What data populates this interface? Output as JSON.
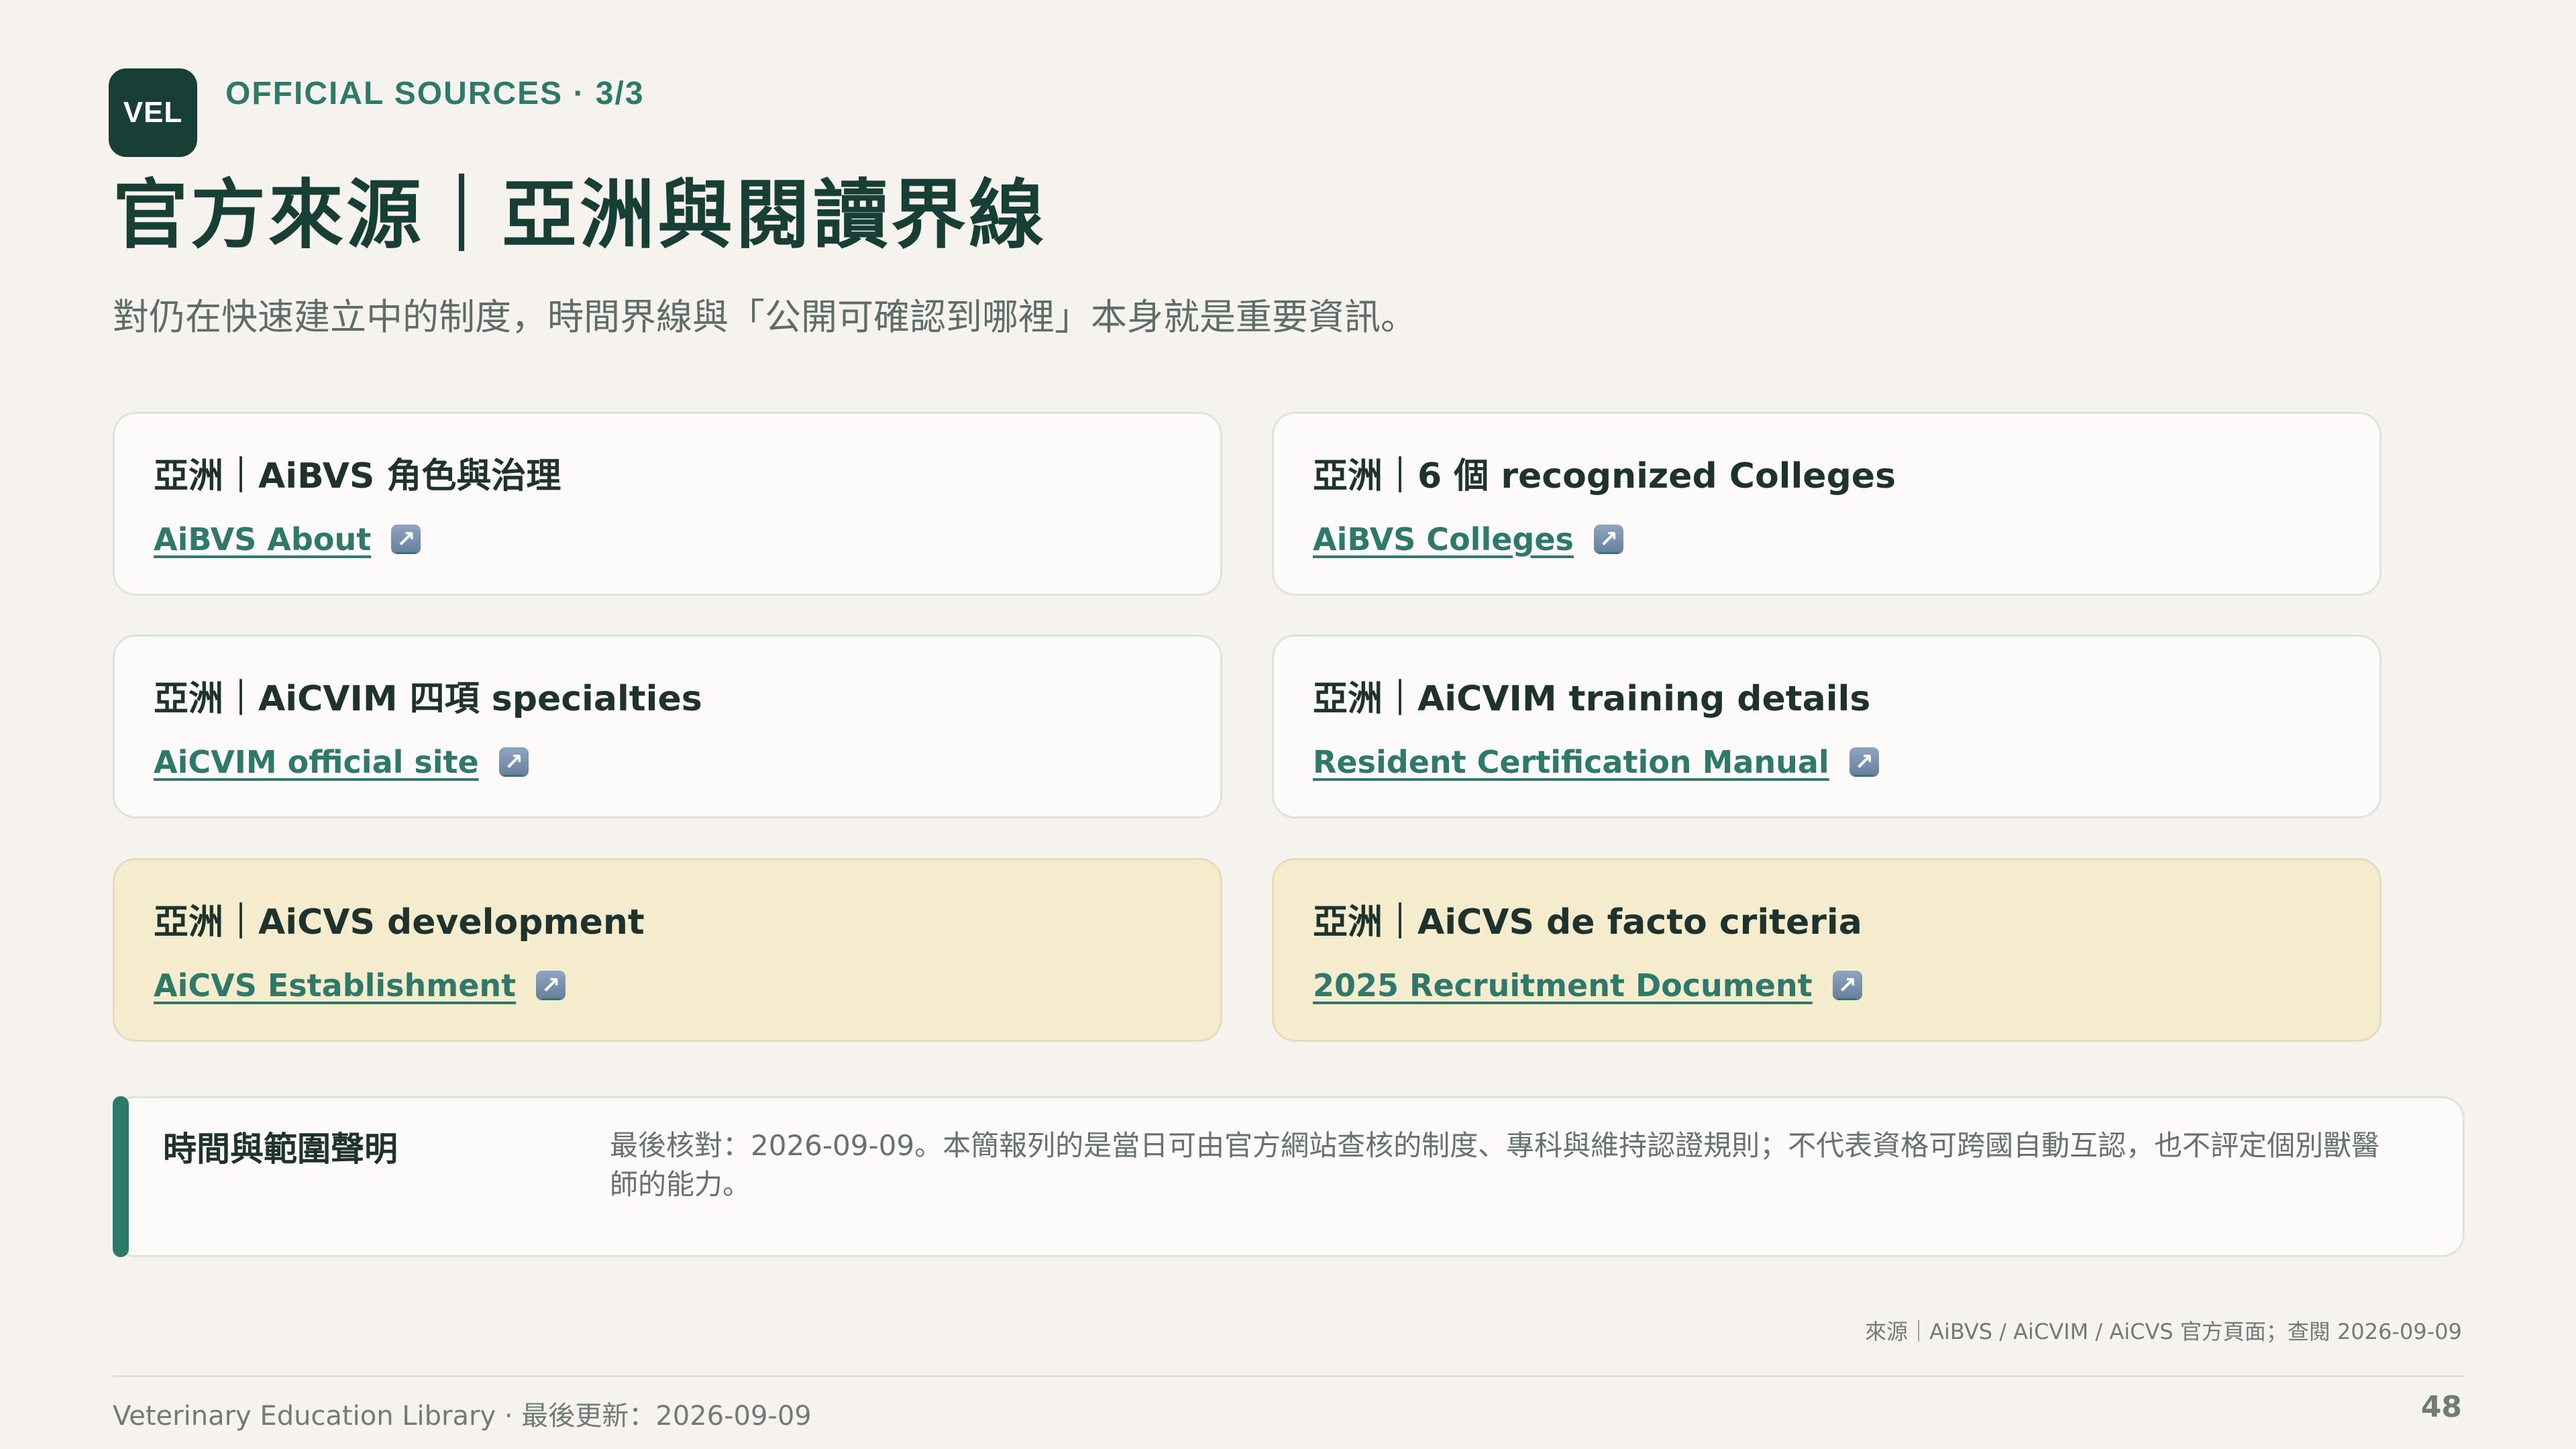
{
  "logo": {
    "text": "VEL"
  },
  "header": {
    "eyebrow": "OFFICIAL SOURCES · 3/3",
    "title": "官方來源｜亞洲與閱讀界線",
    "subtitle": "對仍在快速建立中的制度，時間界線與「公開可確認到哪裡」本身就是重要資訊。"
  },
  "cards": [
    {
      "title": "亞洲｜AiBVS 角色與治理",
      "link": "AiBVS About",
      "icon": "external-link-icon"
    },
    {
      "title": "亞洲｜6 個 recognized Colleges",
      "link": "AiBVS Colleges",
      "icon": "external-link-icon"
    },
    {
      "title": "亞洲｜AiCVIM 四項 specialties",
      "link": "AiCVIM official site",
      "icon": "external-link-icon"
    },
    {
      "title": "亞洲｜AiCVIM training details",
      "link": "Resident Certification Manual",
      "icon": "external-link-icon"
    },
    {
      "title": "亞洲｜AiCVS development",
      "link": "AiCVS Establishment",
      "icon": "external-link-icon"
    },
    {
      "title": "亞洲｜AiCVS de facto criteria",
      "link": "2025 Recruitment Document",
      "icon": "external-link-icon"
    }
  ],
  "note": {
    "title": "時間與範圍聲明",
    "text": "最後核對：2026-09-09。本簡報列的是當日可由官方網站查核的制度、專科與維持認證規則；不代表資格可跨國自動互認，也不評定個別獸醫師的能力。"
  },
  "source_line": "來源｜AiBVS / AiCVIM / AiCVS 官方頁面；查閱 2026-09-09",
  "footer": {
    "left": "Veterinary Education Library · 最後更新：2026-09-09",
    "page": "48"
  },
  "colors": {
    "background": "#f6f3ee",
    "brand_dark": "#173f36",
    "accent": "#2d7a6b",
    "highlight_card": "#f5ebcd"
  }
}
